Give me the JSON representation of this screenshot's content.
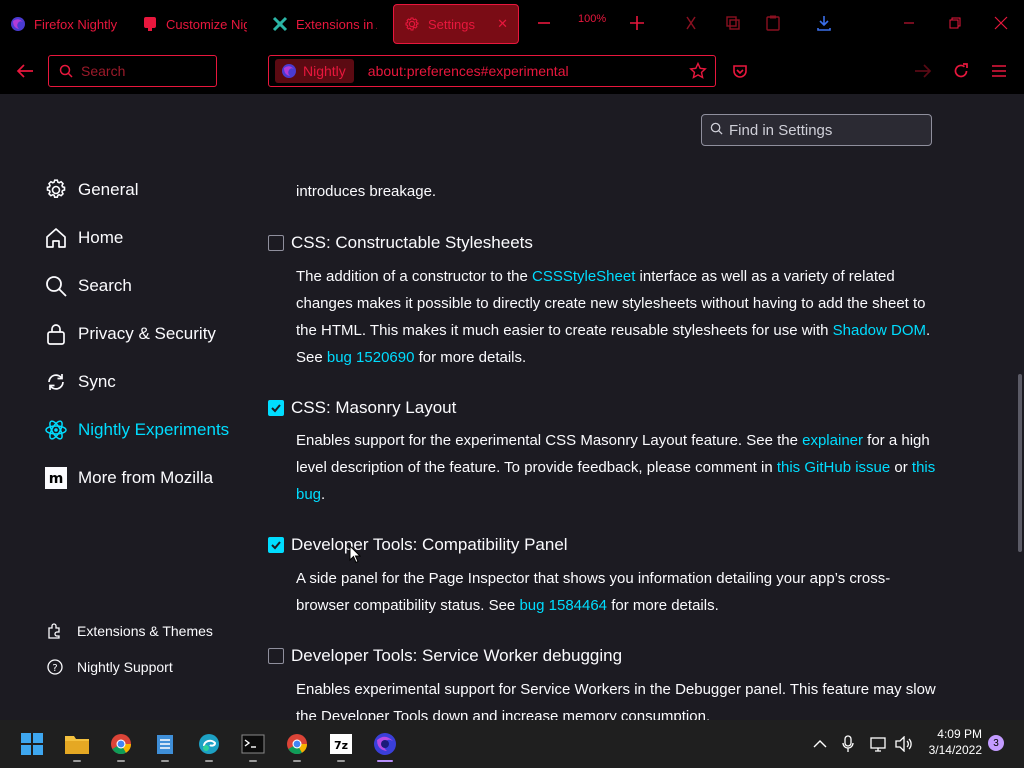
{
  "tabs": [
    {
      "title": "Firefox Nightly",
      "icon": "firefox-nightly-icon"
    },
    {
      "title": "Customize Nightly",
      "icon": "customize-icon"
    },
    {
      "title": "Extensions in Anthro",
      "icon": "extensions-icon"
    },
    {
      "title": "Settings",
      "icon": "gear-icon"
    }
  ],
  "zoom_level": "100%",
  "navbar": {
    "search_placeholder": "Search",
    "identity_label": "Nightly",
    "url": "about:preferences#experimental"
  },
  "find_placeholder": "Find in Settings",
  "categories": [
    {
      "label": "General",
      "icon": "gear-icon"
    },
    {
      "label": "Home",
      "icon": "home-icon"
    },
    {
      "label": "Search",
      "icon": "search-icon"
    },
    {
      "label": "Privacy & Security",
      "icon": "lock-icon"
    },
    {
      "label": "Sync",
      "icon": "sync-icon"
    },
    {
      "label": "Nightly Experiments",
      "icon": "experiments-icon"
    },
    {
      "label": "More from Mozilla",
      "icon": "mozilla-icon"
    }
  ],
  "sidebar_footer": {
    "extensions": "Extensions & Themes",
    "support": "Nightly Support"
  },
  "intro_tail": "introduces breakage.",
  "features": [
    {
      "title": "CSS: Constructable Stylesheets",
      "checked": false,
      "d1": "The addition of a constructor to the ",
      "l1": "CSSStyleSheet",
      "d2": " interface as well as a variety of related changes makes it possible to directly create new stylesheets without having to add the sheet to the HTML. This makes it much easier to create reusable stylesheets for use with ",
      "l2": "Shadow DOM",
      "d3": ". See ",
      "l3": "bug 1520690",
      "d4": " for more details."
    },
    {
      "title": "CSS: Masonry Layout",
      "checked": true,
      "d1": "Enables support for the experimental CSS Masonry Layout feature. See the ",
      "l1": "explainer",
      "d2": " for a high level description of the feature. To provide feedback, please comment in ",
      "l2": "this GitHub issue",
      "d3": " or ",
      "l3": "this bug",
      "d4": "."
    },
    {
      "title": "Developer Tools: Compatibility Panel",
      "checked": true,
      "d1": "A side panel for the Page Inspector that shows you information detailing your app’s cross-browser compatibility status. See ",
      "l1": "bug 1584464",
      "d2": " for more details."
    },
    {
      "title": "Developer Tools: Service Worker debugging",
      "checked": false,
      "d1": "Enables experimental support for Service Workers in the Debugger panel. This feature may slow the Developer Tools down and increase memory consumption."
    }
  ],
  "taskbar": {
    "time": "4:09 PM",
    "date": "3/14/2022",
    "notification_count": "3"
  },
  "colors": {
    "accent_red": "#e8173d",
    "link_cyan": "#00ddff",
    "content_bg": "#1c1b22"
  }
}
